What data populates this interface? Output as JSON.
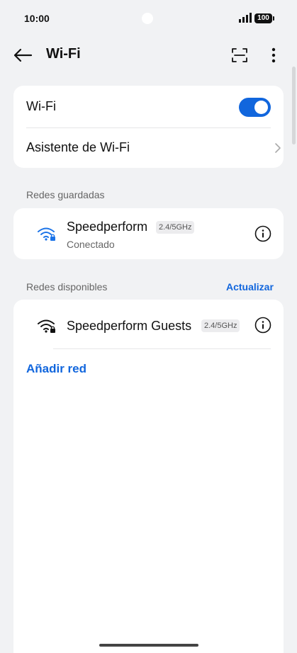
{
  "status_bar": {
    "time": "10:00",
    "battery": "100",
    "icons": [
      "signal-icon",
      "battery-icon"
    ]
  },
  "app_bar": {
    "title": "Wi-Fi",
    "icons": [
      "back-arrow-icon",
      "qr-scan-icon",
      "more-vert-icon"
    ]
  },
  "top_card": {
    "wifi_label": "Wi-Fi",
    "wifi_enabled": true,
    "assistant_label": "Asistente de Wi-Fi"
  },
  "saved_section": {
    "label": "Redes guardadas",
    "networks": [
      {
        "name": "Speedperform",
        "band": "2.4/5GHz",
        "status": "Conectado",
        "connected": true
      }
    ]
  },
  "available_section": {
    "label": "Redes disponibles",
    "refresh_label": "Actualizar",
    "networks": [
      {
        "name": "Speedperform Guests",
        "band": "2.4/5GHz"
      }
    ],
    "add_network_label": "Añadir red"
  },
  "colors": {
    "accent": "#1166dd",
    "background": "#f1f2f4",
    "card": "#ffffff",
    "connected_wifi": "#1a73e8"
  }
}
